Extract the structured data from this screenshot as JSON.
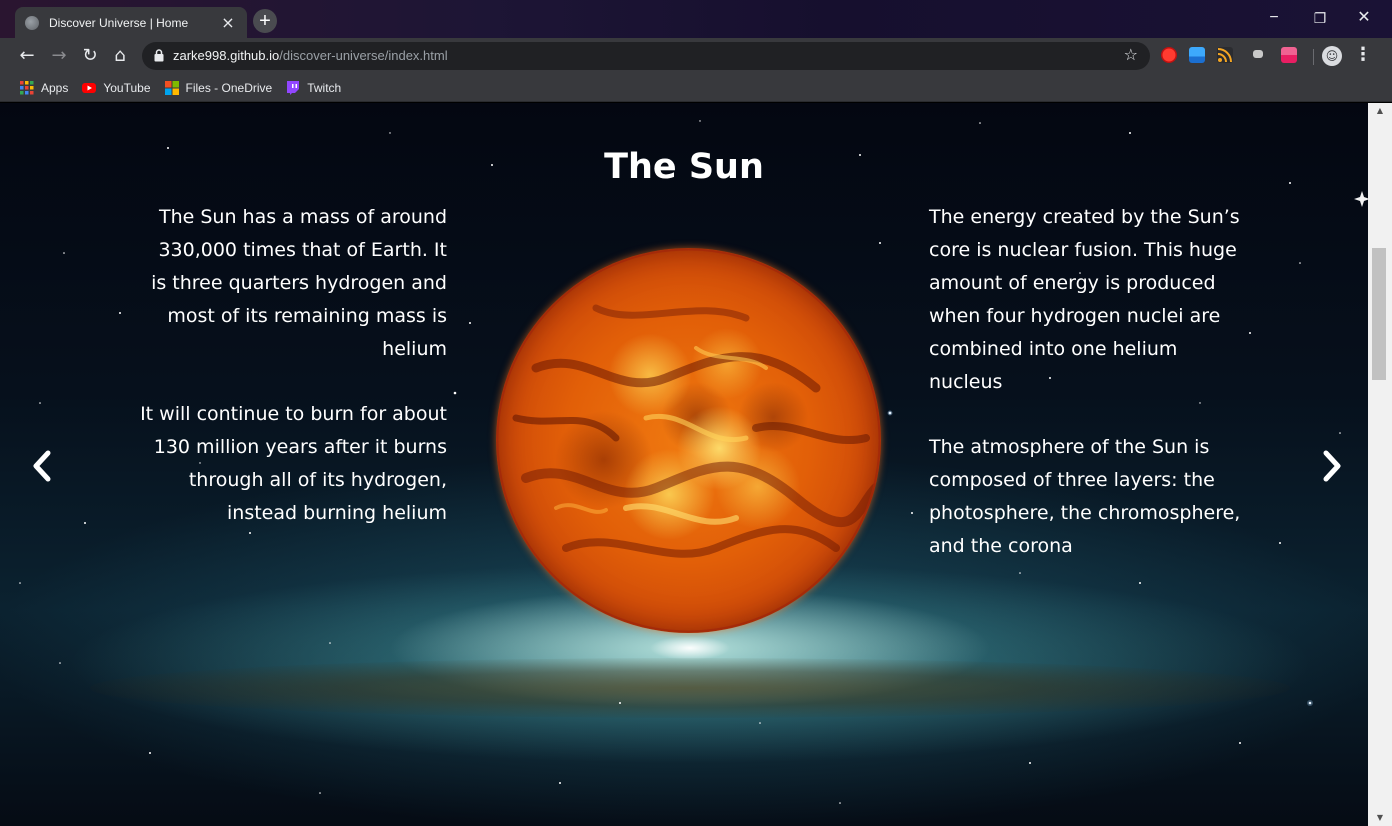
{
  "browser": {
    "tab": {
      "title": "Discover Universe | Home",
      "close_glyph": "×"
    },
    "newtab_glyph": "+",
    "window_controls": {
      "minimize": "−",
      "restore": "❐",
      "close": "✕"
    },
    "nav": {
      "back": "←",
      "forward": "→",
      "reload": "↻",
      "home": "⌂"
    },
    "address": {
      "host": "zarke998.github.io",
      "path": "/discover-universe/index.html"
    },
    "star_glyph": "☆",
    "menu_glyph": "⋮",
    "bookmarks": [
      {
        "label": "Apps"
      },
      {
        "label": "YouTube"
      },
      {
        "label": "Files - OneDrive"
      },
      {
        "label": "Twitch"
      }
    ]
  },
  "page": {
    "title": "The Sun",
    "left_paragraphs": [
      "The Sun has a mass of around 330,000 times that of Earth. It is three quarters hydrogen and most of its remaining mass is helium",
      "It will continue to burn for about 130 million years after it burns through all of its hydrogen, instead burning helium"
    ],
    "right_paragraphs": [
      "The energy created by the Sun’s core is nuclear fusion. This huge amount of energy is produced when four hydrogen nuclei are combined into one helium nucleus",
      "The atmosphere of the Sun is composed of three layers: the photosphere, the chromosphere, and the corona"
    ]
  },
  "colors": {
    "tab_bg": "#38393d",
    "toolbar_bg": "#38393d",
    "omnibox_bg": "#202124",
    "text_white": "#ffffff",
    "sun_core": "#f07a10"
  }
}
